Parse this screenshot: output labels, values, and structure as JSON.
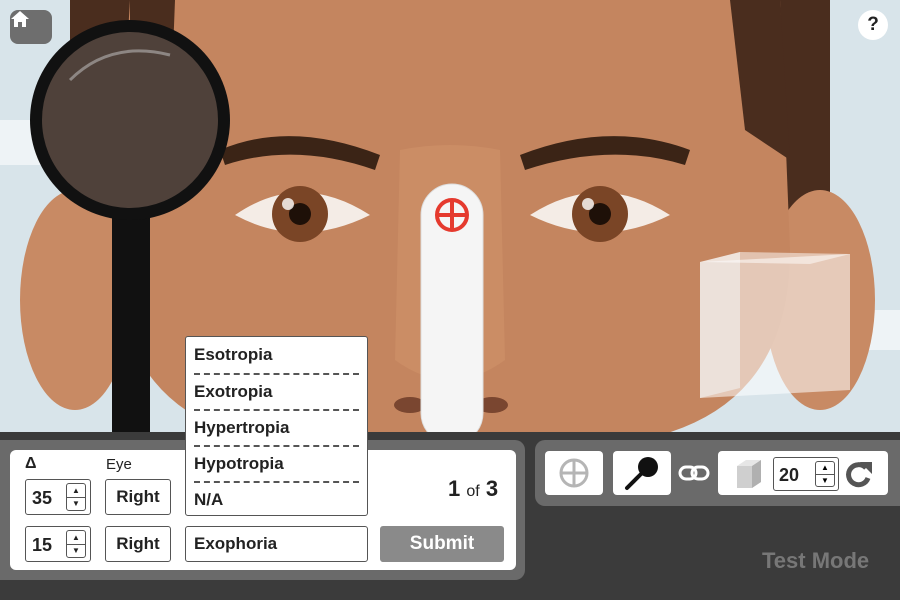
{
  "header": {
    "home_icon": "home-icon",
    "help_label": "?"
  },
  "form": {
    "delta_label": "Δ",
    "eye_label": "Eye",
    "rows": [
      {
        "prism_value": "35",
        "eye": "Right"
      },
      {
        "prism_value": "15",
        "eye": "Right",
        "diagnosis": "Exophoria"
      }
    ],
    "dropdown_options": [
      "Esotropia",
      "Exotropia",
      "Hypertropia",
      "Hypotropia",
      "N/A"
    ],
    "counter": {
      "current": "1",
      "of": "of",
      "total": "3"
    },
    "submit_label": "Submit"
  },
  "tools": {
    "cross_icon": "crosshair-icon",
    "occluder_icon": "occluder-icon",
    "link_icon": "link-icon",
    "prism_icon": "prism-icon",
    "prism_value": "20",
    "rotate_icon": "rotate-icon"
  },
  "mode_label": "Test Mode",
  "colors": {
    "target_red": "#e53a2e",
    "panel_gray": "#6a6a6a",
    "submit_gray": "#8a8a8a"
  }
}
